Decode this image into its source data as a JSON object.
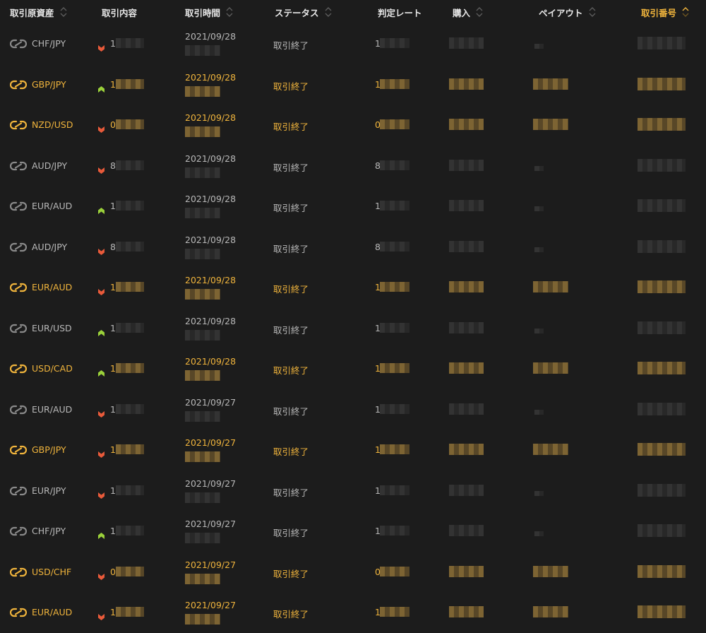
{
  "colors": {
    "background": "#1c1c1c",
    "text": "#b8b8b8",
    "header_text": "#e6e6e6",
    "accent": "#f0b43c",
    "down": "#e85a3a",
    "up": "#9ad03a"
  },
  "columns": [
    {
      "label": "取引原資産",
      "sortable": true,
      "active": false
    },
    {
      "label": "取引内容",
      "sortable": false,
      "active": false
    },
    {
      "label": "取引時間",
      "sortable": true,
      "active": false
    },
    {
      "label": "ステータス",
      "sortable": true,
      "active": false
    },
    {
      "label": "判定レート",
      "sortable": false,
      "active": false
    },
    {
      "label": "購入",
      "sortable": true,
      "active": false
    },
    {
      "label": "ペイアウト",
      "sortable": true,
      "active": false
    },
    {
      "label": "取引番号",
      "sortable": true,
      "active": true
    }
  ],
  "rows": [
    {
      "pair": "CHF/JPY",
      "dir": "down",
      "lead": "1",
      "rate": "1",
      "date": "2021/09/28",
      "status": "取引終了",
      "hl": false,
      "payout_visible": false
    },
    {
      "pair": "GBP/JPY",
      "dir": "up",
      "lead": "1",
      "rate": "1",
      "date": "2021/09/28",
      "status": "取引終了",
      "hl": true,
      "payout_visible": true
    },
    {
      "pair": "NZD/USD",
      "dir": "down",
      "lead": "0",
      "rate": "0",
      "date": "2021/09/28",
      "status": "取引終了",
      "hl": true,
      "payout_visible": true
    },
    {
      "pair": "AUD/JPY",
      "dir": "down",
      "lead": "8",
      "rate": "8",
      "date": "2021/09/28",
      "status": "取引終了",
      "hl": false,
      "payout_visible": false
    },
    {
      "pair": "EUR/AUD",
      "dir": "up",
      "lead": "1",
      "rate": "1",
      "date": "2021/09/28",
      "status": "取引終了",
      "hl": false,
      "payout_visible": false
    },
    {
      "pair": "AUD/JPY",
      "dir": "down",
      "lead": "8",
      "rate": "8",
      "date": "2021/09/28",
      "status": "取引終了",
      "hl": false,
      "payout_visible": false
    },
    {
      "pair": "EUR/AUD",
      "dir": "down",
      "lead": "1",
      "rate": "1",
      "date": "2021/09/28",
      "status": "取引終了",
      "hl": true,
      "payout_visible": true
    },
    {
      "pair": "EUR/USD",
      "dir": "up",
      "lead": "1",
      "rate": "1",
      "date": "2021/09/28",
      "status": "取引終了",
      "hl": false,
      "payout_visible": false
    },
    {
      "pair": "USD/CAD",
      "dir": "up",
      "lead": "1",
      "rate": "1",
      "date": "2021/09/28",
      "status": "取引終了",
      "hl": true,
      "payout_visible": true
    },
    {
      "pair": "EUR/AUD",
      "dir": "down",
      "lead": "1",
      "rate": "1",
      "date": "2021/09/27",
      "status": "取引終了",
      "hl": false,
      "payout_visible": false
    },
    {
      "pair": "GBP/JPY",
      "dir": "down",
      "lead": "1",
      "rate": "1",
      "date": "2021/09/27",
      "status": "取引終了",
      "hl": true,
      "payout_visible": true
    },
    {
      "pair": "EUR/JPY",
      "dir": "down",
      "lead": "1",
      "rate": "1",
      "date": "2021/09/27",
      "status": "取引終了",
      "hl": false,
      "payout_visible": false
    },
    {
      "pair": "CHF/JPY",
      "dir": "up",
      "lead": "1",
      "rate": "1",
      "date": "2021/09/27",
      "status": "取引終了",
      "hl": false,
      "payout_visible": false
    },
    {
      "pair": "USD/CHF",
      "dir": "down",
      "lead": "0",
      "rate": "0",
      "date": "2021/09/27",
      "status": "取引終了",
      "hl": true,
      "payout_visible": true
    },
    {
      "pair": "EUR/AUD",
      "dir": "down",
      "lead": "1",
      "rate": "1",
      "date": "2021/09/27",
      "status": "取引終了",
      "hl": true,
      "payout_visible": true
    }
  ]
}
